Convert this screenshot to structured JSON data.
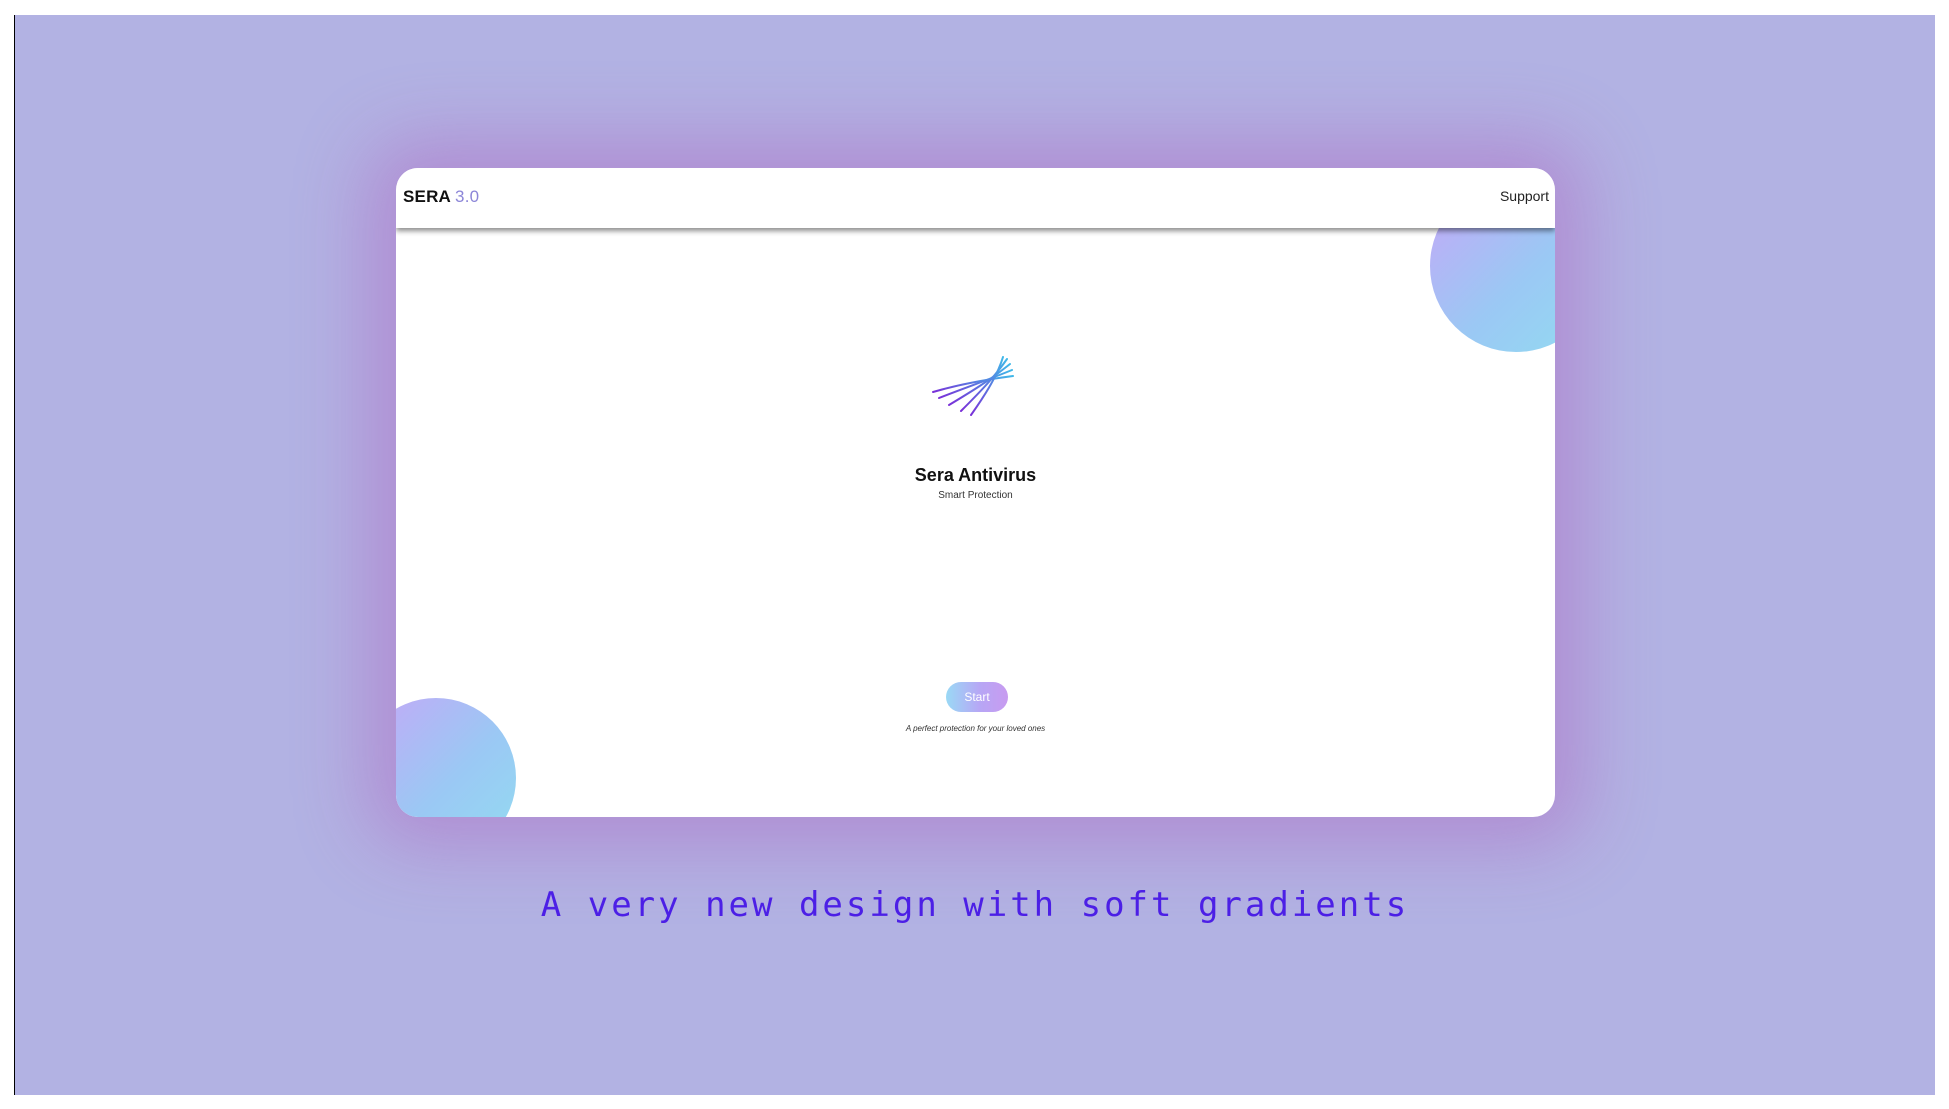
{
  "app": {
    "brand": "SERA",
    "version": "3.0",
    "support_label": "Support"
  },
  "hero": {
    "product_name": "Sera Antivirus",
    "subtitle": "Smart Protection",
    "start_label": "Start",
    "tagline": "A perfect protection for your loved ones"
  },
  "caption": {
    "text": "A very new design with soft gradients"
  },
  "colors": {
    "background": "#b2b2e3",
    "brand_version": "#8c86d8",
    "caption": "#4c1fe6",
    "gradient_blue": "#92dcf1",
    "gradient_violet": "#c6a7f7"
  }
}
